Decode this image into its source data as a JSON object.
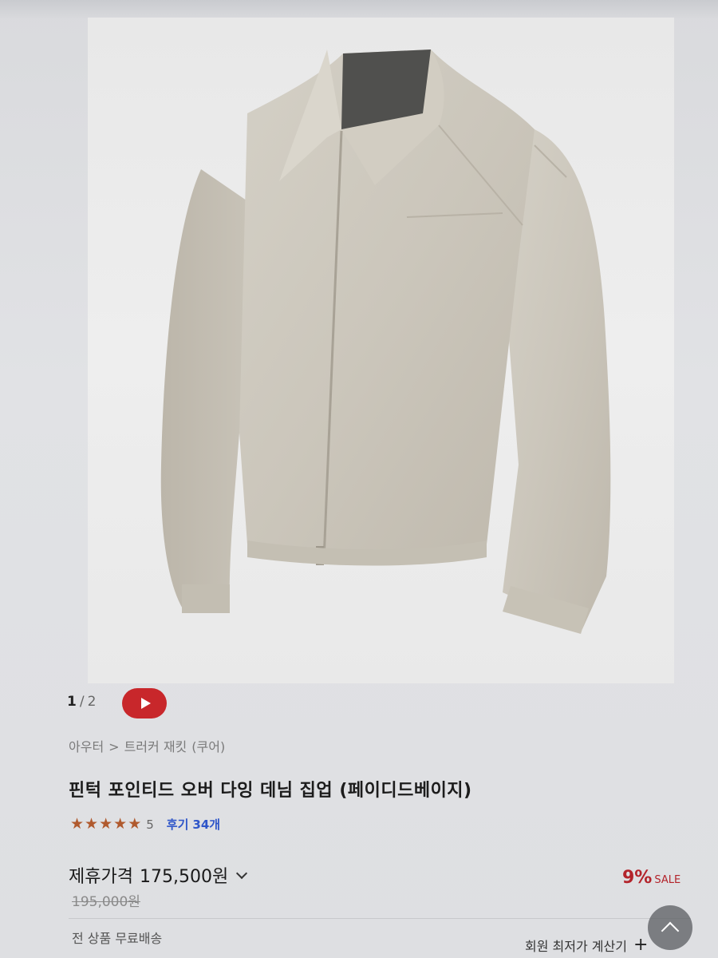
{
  "gallery": {
    "current": "1",
    "separator": "/",
    "total": "2",
    "video_icon": "play-icon",
    "video_color": "#c8272b"
  },
  "breadcrumb": {
    "category": "아우터",
    "separator": ">",
    "subcategory": "트러커 재킷",
    "brand": "(쿠어)"
  },
  "product": {
    "title": "핀턱 포인티드 오버 다잉 데님 집업 (페이디드베이지)",
    "rating_value": 5,
    "rating_label": "5",
    "reviews_label": "후기",
    "reviews_count": "34개",
    "star_color": "#b05a2e"
  },
  "price": {
    "label": "제휴가격",
    "value": "175,500원",
    "original": "195,000원",
    "discount_pct": "9%",
    "discount_label": "SALE",
    "discount_color": "#b3242b"
  },
  "footer": {
    "shipping": "전 상품 무료배송",
    "calculator": "회원 최저가 계산기",
    "calculator_icon": "plus-icon",
    "scroll_icon": "chevron-up-icon"
  }
}
